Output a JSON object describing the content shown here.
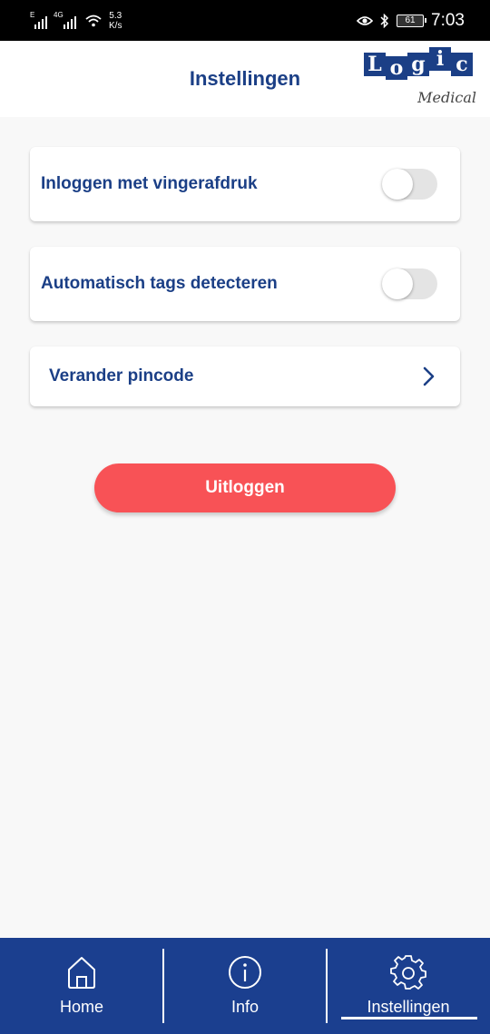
{
  "status_bar": {
    "signal1_label": "E",
    "signal2_label": "4G",
    "speed_value": "5.3",
    "speed_unit": "K/s",
    "battery": "61",
    "time": "7:03"
  },
  "header": {
    "title": "Instellingen",
    "logo_letters": [
      "L",
      "o",
      "g",
      "i",
      "c"
    ],
    "logo_subtitle": "Medical"
  },
  "settings": {
    "fingerprint_label": "Inloggen met vingerafdruk",
    "fingerprint_enabled": false,
    "auto_tags_label": "Automatisch tags detecteren",
    "auto_tags_enabled": false,
    "change_pin_label": "Verander pincode"
  },
  "logout_label": "Uitloggen",
  "nav": {
    "home_label": "Home",
    "info_label": "Info",
    "settings_label": "Instellingen",
    "active": "Instellingen"
  },
  "colors": {
    "brand_blue": "#1b3f86",
    "nav_blue": "#1b3f8f",
    "logout_red": "#f85256"
  },
  "icons": [
    "signal-icon",
    "wifi-icon",
    "eye-icon",
    "bluetooth-icon",
    "battery-icon",
    "chevron-right-icon",
    "home-icon",
    "info-icon",
    "gear-icon"
  ]
}
